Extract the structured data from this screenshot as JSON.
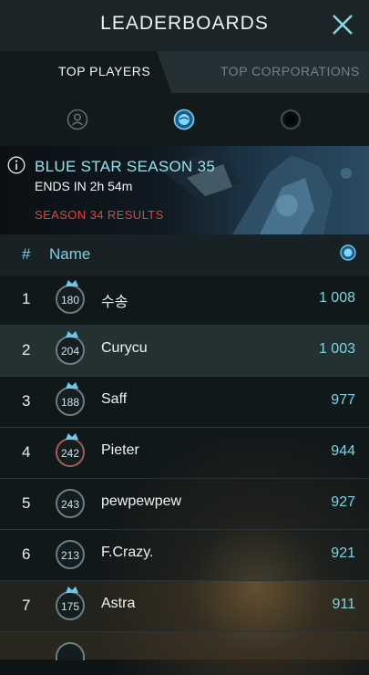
{
  "header": {
    "title": "LEADERBOARDS"
  },
  "tabs": [
    {
      "label": "TOP PLAYERS",
      "active": true
    },
    {
      "label": "TOP CORPORATIONS",
      "active": false
    }
  ],
  "filters": [
    "player-target-icon",
    "blue-star-icon",
    "dark-star-icon"
  ],
  "season": {
    "title": "BLUE STAR SEASON 35",
    "ends": "ENDS IN 2h 54m",
    "results_link": "SEASON 34 RESULTS"
  },
  "columns": {
    "rank": "#",
    "name": "Name"
  },
  "rows": [
    {
      "rank": "1",
      "level": "180",
      "name": "수송",
      "score": "1 008"
    },
    {
      "rank": "2",
      "level": "204",
      "name": "Curycu",
      "score": "1 003"
    },
    {
      "rank": "3",
      "level": "188",
      "name": "Saff",
      "score": "977"
    },
    {
      "rank": "4",
      "level": "242",
      "name": "Pieter",
      "score": "944"
    },
    {
      "rank": "5",
      "level": "243",
      "name": "pewpewpew",
      "score": "927"
    },
    {
      "rank": "6",
      "level": "213",
      "name": "F.Crazy.",
      "score": "921"
    },
    {
      "rank": "7",
      "level": "175",
      "name": "Astra",
      "score": "911"
    }
  ],
  "colors": {
    "accent": "#7fcfe0",
    "danger": "#e0443e",
    "highlight_row": "#243133"
  }
}
